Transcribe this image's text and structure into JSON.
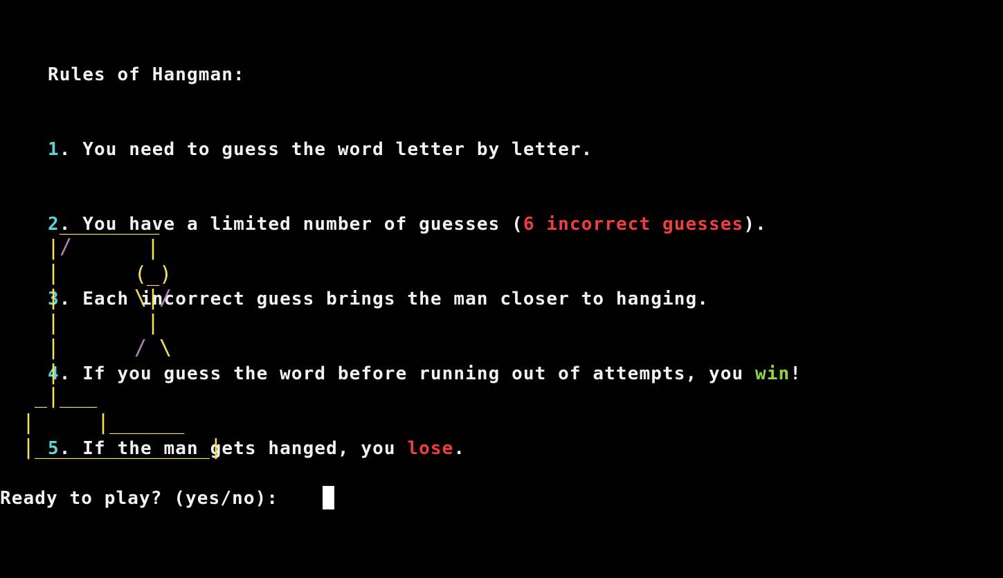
{
  "colors": {
    "background": "#000000",
    "text": "#f2f2f2",
    "number": "#5fd4d4",
    "emphasis_red": "#ee3f3f",
    "emphasis_green": "#8cd640",
    "gallows": "#f6e05e",
    "gallows_accent": "#b07fbf"
  },
  "rules": {
    "title": "Rules of Hangman:",
    "items": [
      {
        "num": "1",
        "parts": [
          "You need to guess the word letter by letter."
        ]
      },
      {
        "num": "2",
        "parts": [
          "You have a limited number of guesses (",
          "6 incorrect guesses",
          ")."
        ]
      },
      {
        "num": "3",
        "parts": [
          "Each incorrect guess brings the man closer to hanging."
        ]
      },
      {
        "num": "4",
        "parts": [
          "If you guess the word before running out of attempts, you ",
          "win",
          "!"
        ]
      },
      {
        "num": "5",
        "parts": [
          "If the man gets hanged, you ",
          "lose",
          "."
        ]
      }
    ]
  },
  "gallows": {
    "top_beam": "________",
    "row1_left": "|",
    "row1_slash": "/",
    "row1_rope": "|",
    "head": "(_)",
    "arm_left": "\\",
    "body_mid": "|",
    "arm_right": "/",
    "torso": "|",
    "leg_left": "/",
    "leg_right": "\\",
    "post": "|",
    "base_top": "_|___",
    "base_mid_left": "|",
    "base_mid_right": "|______",
    "base_bottom": "|______________|"
  },
  "prompt": {
    "text": "Ready to play? (yes/no): "
  }
}
